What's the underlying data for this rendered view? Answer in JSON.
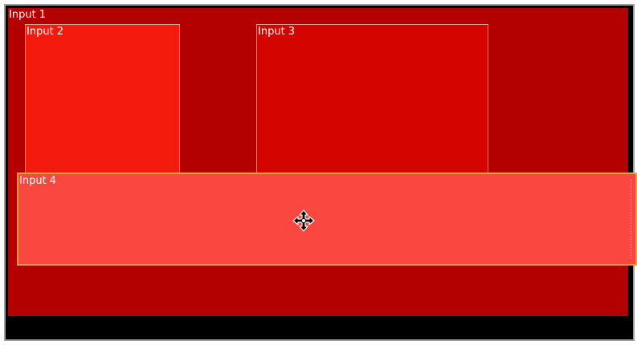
{
  "inputs": [
    {
      "id": "input-1",
      "label": "Input 1",
      "color": "#b30000"
    },
    {
      "id": "input-2",
      "label": "Input 2",
      "color": "#f51a0e"
    },
    {
      "id": "input-3",
      "label": "Input 3",
      "color": "#d40500"
    },
    {
      "id": "input-4",
      "label": "Input 4",
      "color": "#fa4840",
      "selected": true
    }
  ],
  "cursor": {
    "icon": "move-cursor-icon"
  },
  "colors": {
    "background": "#000000",
    "selection_border": "#f2a233",
    "frame_border": "#9e9e9e"
  }
}
